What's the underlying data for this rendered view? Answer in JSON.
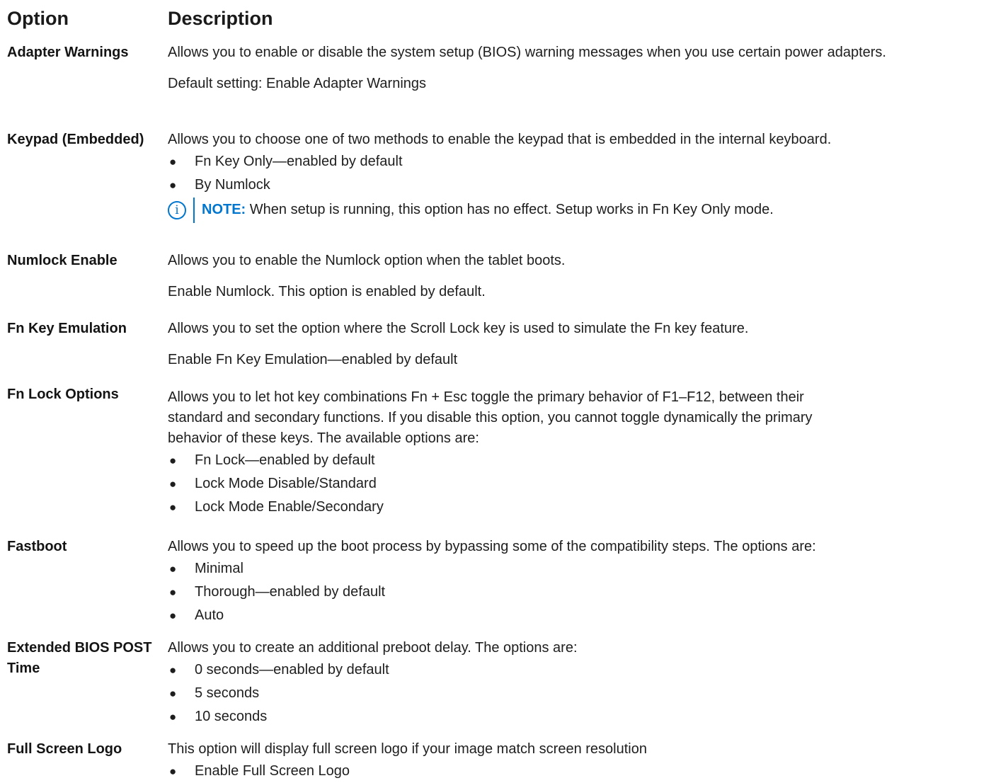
{
  "header": {
    "option": "Option",
    "description": "Description"
  },
  "rows": [
    {
      "option": "Adapter Warnings",
      "paras": [
        "Allows you to enable or disable the system setup (BIOS) warning messages when you use certain power adapters.",
        "Default setting: Enable Adapter Warnings"
      ]
    },
    {
      "option": "Keypad (Embedded)",
      "intro": "Allows you to choose one of two methods to enable the keypad that is embedded in the internal keyboard.",
      "bullets": [
        "Fn Key Only—enabled by default",
        "By Numlock"
      ],
      "note": {
        "label": "NOTE:",
        "text": " When setup is running, this option has no effect. Setup works in Fn Key Only mode."
      }
    },
    {
      "option": "Numlock Enable",
      "paras": [
        "Allows you to enable the Numlock option when the tablet boots.",
        "Enable Numlock. This option is enabled by default."
      ]
    },
    {
      "option": "Fn Key Emulation",
      "paras": [
        "Allows you to set the option where the Scroll Lock key is used to simulate the Fn key feature.",
        "Enable Fn Key Emulation—enabled by default"
      ]
    },
    {
      "option": "Fn Lock Options",
      "intro_lines": [
        "Allows you to let hot key combinations Fn + Esc toggle the primary behavior of F1–F12, between their",
        "standard and secondary functions. If you disable this option, you cannot toggle dynamically the primary",
        "behavior of these keys. The available options are:"
      ],
      "bullets": [
        "Fn Lock—enabled by default",
        "Lock Mode Disable/Standard",
        "Lock Mode Enable/Secondary"
      ]
    },
    {
      "option": "Fastboot",
      "intro": "Allows you to speed up the boot process by bypassing some of the compatibility steps. The options are:",
      "bullets": [
        "Minimal",
        "Thorough—enabled by default",
        "Auto"
      ]
    },
    {
      "option": "Extended BIOS POST Time",
      "intro": "Allows you to create an additional preboot delay. The options are:",
      "bullets": [
        "0 seconds—enabled by default",
        "5 seconds",
        "10 seconds"
      ]
    },
    {
      "option": "Full Screen Logo",
      "intro": "This option will display full screen logo if your image match screen resolution",
      "bullets": [
        "Enable Full Screen Logo"
      ]
    }
  ],
  "bullet_glyph": "●",
  "icons": {
    "note": "info-circle-icon"
  },
  "colors": {
    "accent": "#0076ce",
    "text": "#1a1a1a"
  }
}
